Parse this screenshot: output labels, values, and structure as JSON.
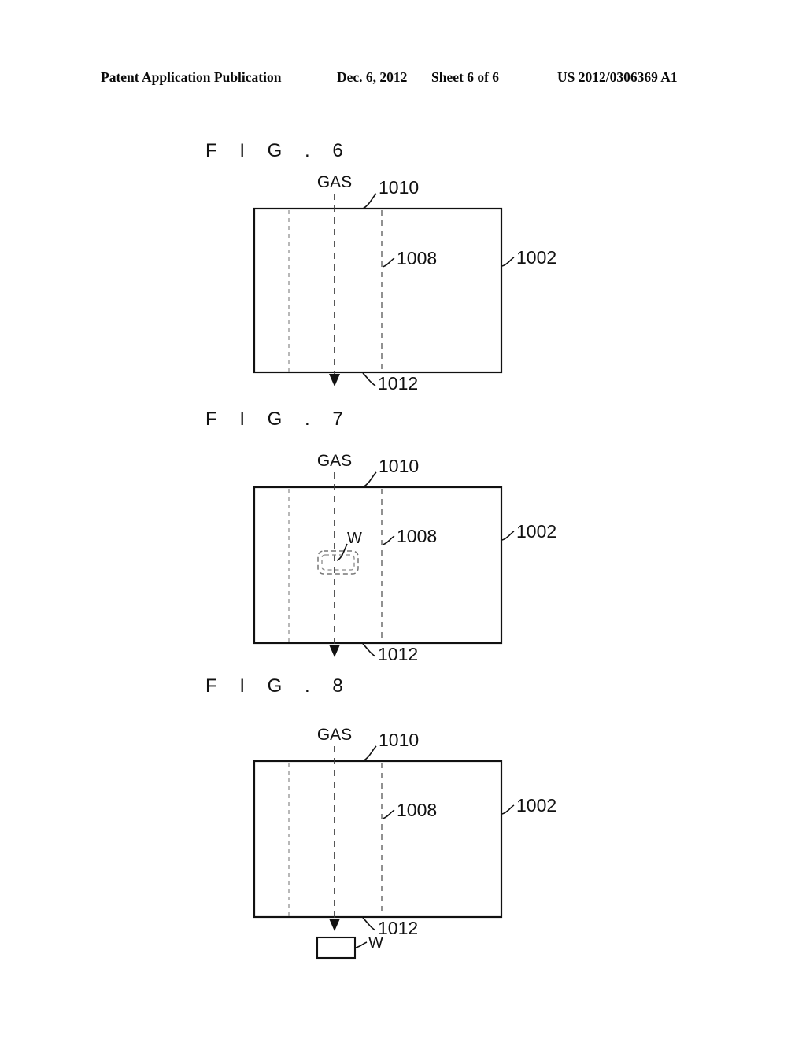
{
  "header": {
    "publication": "Patent Application Publication",
    "date": "Dec. 6, 2012",
    "sheet": "Sheet 6 of 6",
    "patent_number": "US 2012/0306369 A1"
  },
  "figures": [
    {
      "id": "fig6",
      "label": "F I G .  6",
      "gas_label": "GAS",
      "callouts": {
        "chamber": "1002",
        "upper_zone": "1010",
        "mid_zone": "1008",
        "lower_zone": "1012"
      },
      "wafer": null
    },
    {
      "id": "fig7",
      "label": "F I G .  7",
      "gas_label": "GAS",
      "callouts": {
        "chamber": "1002",
        "upper_zone": "1010",
        "mid_zone": "1008",
        "lower_zone": "1012"
      },
      "wafer": {
        "label": "W",
        "position": "inside-chamber-center"
      }
    },
    {
      "id": "fig8",
      "label": "F I G .  8",
      "gas_label": "GAS",
      "callouts": {
        "chamber": "1002",
        "upper_zone": "1010",
        "mid_zone": "1008",
        "lower_zone": "1012"
      },
      "wafer": {
        "label": "W",
        "position": "below-chamber-outlet"
      }
    }
  ],
  "colors": {
    "ink": "#111111",
    "paper": "#ffffff",
    "light_line": "#9a9a9a",
    "mid_line": "#6d6d6d"
  }
}
